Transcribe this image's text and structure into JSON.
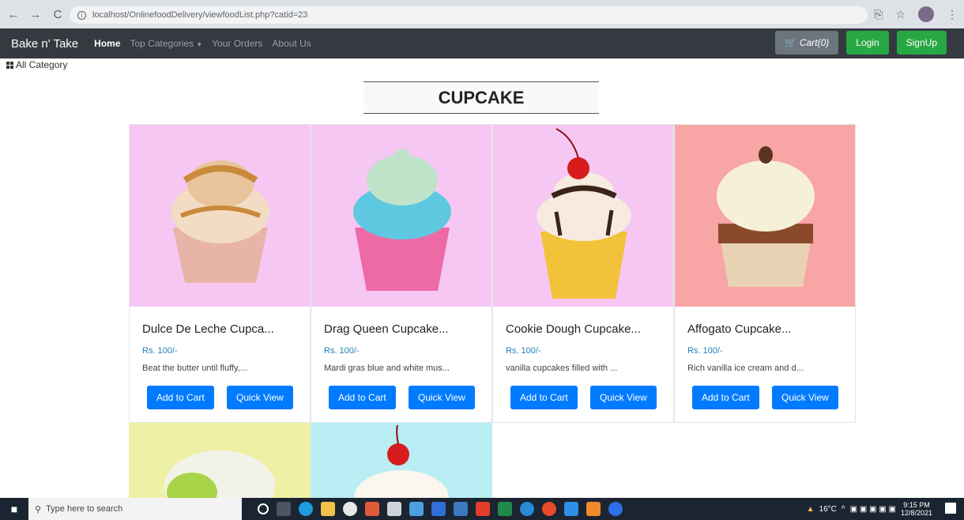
{
  "browser": {
    "url": "localhost/OnlinefoodDelivery/viewfoodList.php?catid=23"
  },
  "navbar": {
    "brand": "Bake n' Take",
    "links": [
      "Home",
      "Top Categories",
      "Your Orders",
      "About Us"
    ],
    "cart": "Cart(0)",
    "login": "Login",
    "signup": "SignUp"
  },
  "all_category": "All Category",
  "page_title": "CUPCAKE",
  "products": [
    {
      "name": "Dulce De Leche Cupca...",
      "price": "Rs. 100/-",
      "desc": "Beat the butter until fluffy,...",
      "bg": "#f6c7f3"
    },
    {
      "name": "Drag Queen Cupcake...",
      "price": "Rs. 100/-",
      "desc": "Mardi gras blue and white mus...",
      "bg": "#f6c7f3"
    },
    {
      "name": "Cookie Dough Cupcake...",
      "price": "Rs. 100/-",
      "desc": "vanilla cupcakes filled with ...",
      "bg": "#f6c7f3"
    },
    {
      "name": "Affogato Cupcake...",
      "price": "Rs. 100/-",
      "desc": "Rich vanilla ice cream and d...",
      "bg": "#f8a5a5"
    }
  ],
  "buttons": {
    "add": "Add to Cart",
    "quick": "Quick View"
  },
  "taskbar": {
    "search_placeholder": "Type here to search",
    "weather": "16°C",
    "time": "9:15 PM",
    "date": "12/8/2021"
  }
}
